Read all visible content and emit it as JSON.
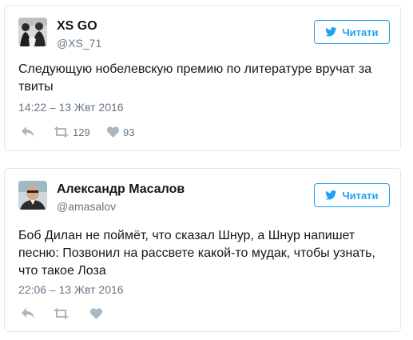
{
  "tweets": [
    {
      "display_name": "XS GO",
      "handle": "@XS_71",
      "follow_label": "Читати",
      "text": "Следующую нобелевскую премию по литературе вручат за твиты",
      "timestamp": "14:22 – 13 Жвт 2016",
      "retweet_count": "129",
      "like_count": "93",
      "icons": [
        "avatar",
        "twitter-bird-icon",
        "reply-icon",
        "retweet-icon",
        "heart-icon"
      ]
    },
    {
      "display_name": "Александр Масалов",
      "handle": "@amasalov",
      "follow_label": "Читати",
      "text": "Боб Дилан не поймёт, что сказал Шнур, а Шнур напишет песню: Позвонил на рассвете какой-то мудак, чтобы узнать, что такое Лоза",
      "timestamp": "22:06 – 13 Жвт 2016",
      "retweet_count": "",
      "like_count": "",
      "icons": [
        "avatar",
        "twitter-bird-icon",
        "reply-icon",
        "retweet-icon",
        "heart-icon"
      ]
    }
  ],
  "colors": {
    "accent": "#1da1f2",
    "muted_text": "#657786",
    "icon_gray": "#aab8c2",
    "border": "#e1e8ed"
  }
}
